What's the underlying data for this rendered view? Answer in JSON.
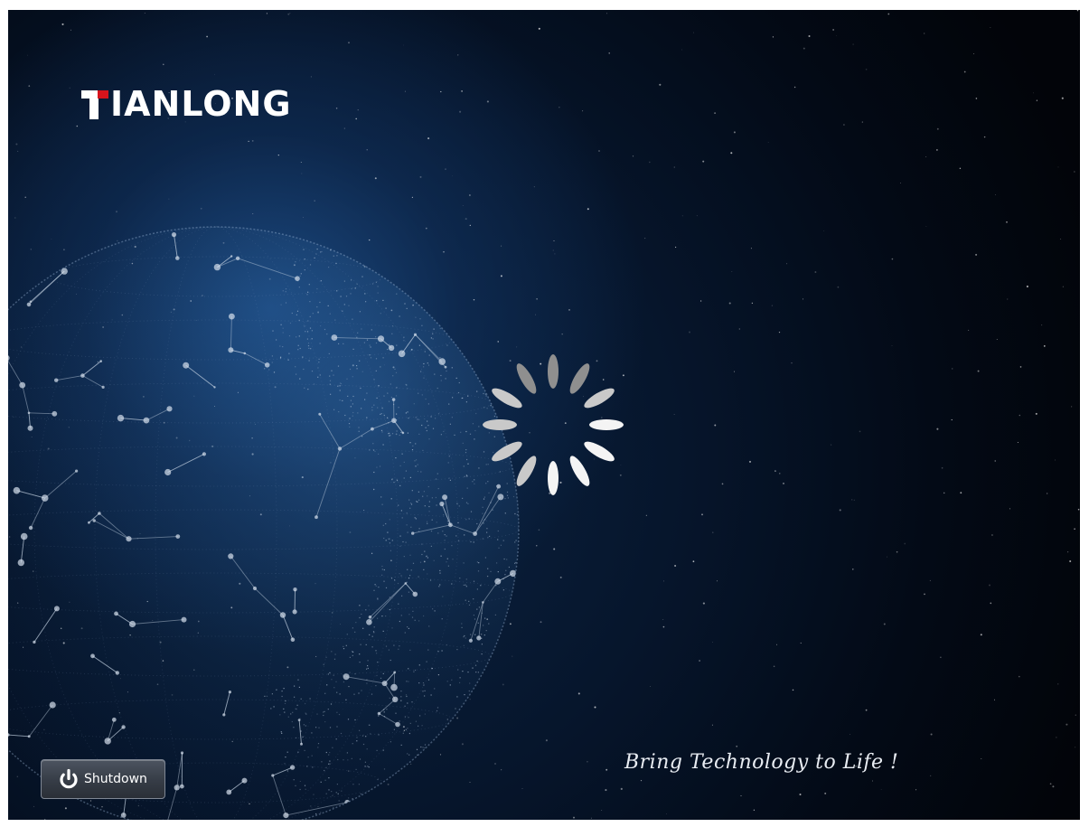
{
  "brand": {
    "name": "IANLONG",
    "mark_colors": {
      "white": "#ffffff",
      "red": "#d8141c"
    }
  },
  "loading": {
    "indicator": "spinner",
    "icon": "loading-spinner-icon"
  },
  "tagline": "Bring Technology to Life !",
  "shutdown_button": {
    "label": "Shutdown",
    "icon": "power-icon"
  },
  "colors": {
    "background_dark": "#020409",
    "background_glow": "#1e508c",
    "text": "#ffffff"
  }
}
